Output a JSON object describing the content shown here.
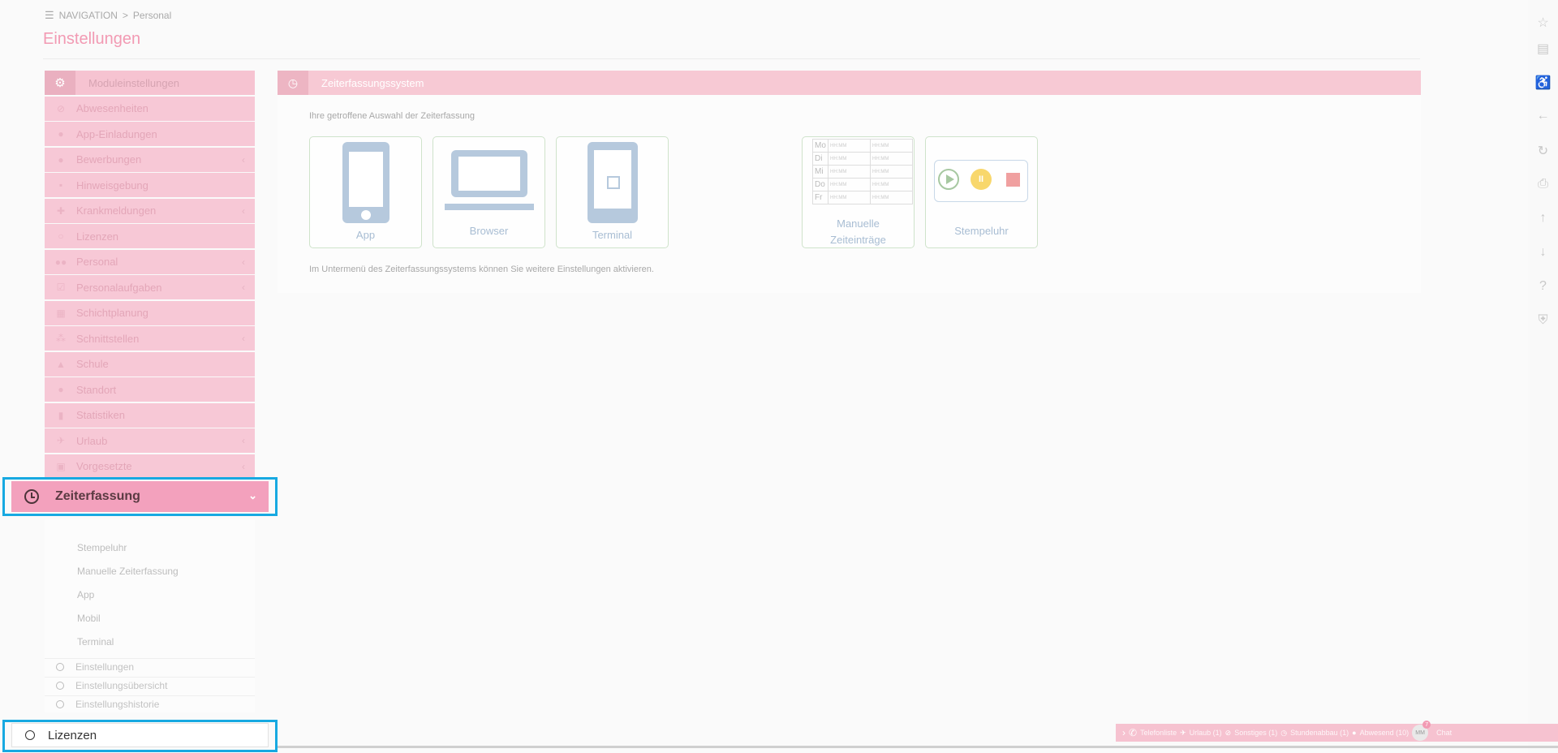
{
  "breadcrumb": {
    "root": "NAVIGATION",
    "sep": ">",
    "current": "Personal"
  },
  "page_title": "Einstellungen",
  "sidebar": {
    "header": "Moduleinstellungen",
    "items": [
      {
        "label": "Abwesenheiten",
        "icon": "⊘",
        "chev": ""
      },
      {
        "label": "App-Einladungen",
        "icon": "●",
        "chev": ""
      },
      {
        "label": "Bewerbungen",
        "icon": "●",
        "chev": "‹"
      },
      {
        "label": "Hinweisgebung",
        "icon": "▪",
        "chev": ""
      },
      {
        "label": "Krankmeldungen",
        "icon": "✚",
        "chev": "‹"
      },
      {
        "label": "Lizenzen",
        "icon": "○",
        "chev": ""
      },
      {
        "label": "Personal",
        "icon": "●●",
        "chev": "‹"
      },
      {
        "label": "Personalaufgaben",
        "icon": "☑",
        "chev": "‹"
      },
      {
        "label": "Schichtplanung",
        "icon": "▦",
        "chev": ""
      },
      {
        "label": "Schnittstellen",
        "icon": "⁂",
        "chev": "‹"
      },
      {
        "label": "Schule",
        "icon": "▲",
        "chev": ""
      },
      {
        "label": "Standort",
        "icon": "●",
        "chev": ""
      },
      {
        "label": "Statistiken",
        "icon": "▮",
        "chev": ""
      },
      {
        "label": "Urlaub",
        "icon": "✈",
        "chev": "‹"
      },
      {
        "label": "Vorgesetzte",
        "icon": "▣",
        "chev": "‹"
      }
    ],
    "active": {
      "label": "Zeiterfassung",
      "chev": "⌄"
    },
    "submenu": [
      "Stempeluhr",
      "Manuelle Zeiterfassung",
      "App",
      "Mobil",
      "Terminal"
    ],
    "settings": [
      "Einstellungen",
      "Einstellungsübersicht",
      "Einstellungshistorie"
    ],
    "highlight_bottom": "Lizenzen"
  },
  "panel": {
    "title": "Zeiterfassungssystem",
    "selection_label": "Ihre getroffene Auswahl der Zeiterfassung",
    "note": "Im Untermenü des Zeiterfassungssystems können Sie weitere Einstellungen aktivieren.",
    "cards": {
      "app": "App",
      "browser": "Browser",
      "terminal": "Terminal",
      "manual_1": "Manuelle",
      "manual_2": "Zeiteinträge",
      "stamp": "Stempeluhr"
    },
    "days": [
      "Mo",
      "Di",
      "Mi",
      "Do",
      "Fr"
    ],
    "time_placeholder": "HH:MM",
    "pause_glyph": "II"
  },
  "chatbar": {
    "items": [
      "Telefonliste",
      "Urlaub (1)",
      "Sonstiges (1)",
      "Stundenabbau (1)",
      "Abwesend (10)"
    ],
    "avatar": "MM",
    "badge": "7",
    "chat": "Chat"
  },
  "colors": {
    "accent": "#f29ab3",
    "highlight": "#17a9e1"
  }
}
